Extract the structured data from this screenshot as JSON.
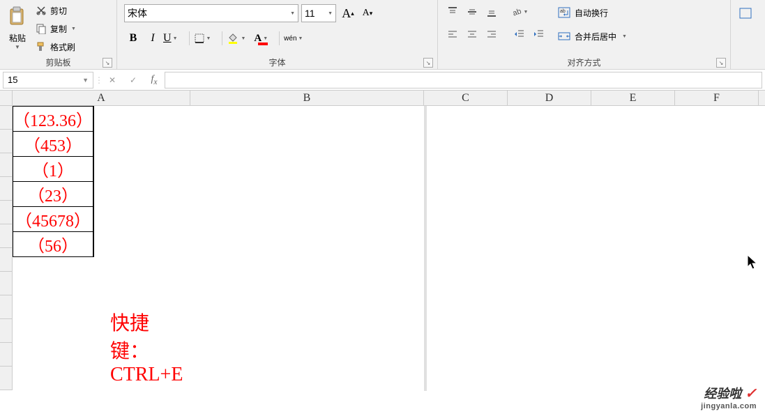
{
  "ribbon": {
    "clipboard": {
      "paste_label": "粘贴",
      "cut_label": "剪切",
      "copy_label": "复制",
      "format_painter_label": "格式刷",
      "group_label": "剪贴板"
    },
    "font": {
      "font_name": "宋体",
      "font_size": "11",
      "bold": "B",
      "italic": "I",
      "underline": "U",
      "phonetic": "wén",
      "group_label": "字体"
    },
    "alignment": {
      "wrap_text_label": "自动换行",
      "merge_center_label": "合并后居中",
      "group_label": "对齐方式"
    }
  },
  "formula_bar": {
    "name_box": "15",
    "formula": ""
  },
  "columns": [
    "A",
    "B",
    "C",
    "D",
    "E",
    "F"
  ],
  "table": {
    "rows": [
      {
        "a": "（123.36）",
        "b": ""
      },
      {
        "a": "（453）",
        "b": ""
      },
      {
        "a": "（1）",
        "b": ""
      },
      {
        "a": "（23）",
        "b": ""
      },
      {
        "a": "（45678）",
        "b": ""
      },
      {
        "a": "（56）",
        "b": ""
      }
    ]
  },
  "annotation": "快捷键：CTRL+E",
  "watermark": {
    "brand": "经验啦",
    "url": "jingyanla.com"
  },
  "chart_data": {
    "type": "table",
    "columns": [
      "A",
      "B"
    ],
    "rows": [
      [
        "（123.36）",
        ""
      ],
      [
        "（453）",
        ""
      ],
      [
        "（1）",
        ""
      ],
      [
        "（23）",
        ""
      ],
      [
        "（45678）",
        ""
      ],
      [
        "（56）",
        ""
      ]
    ]
  }
}
